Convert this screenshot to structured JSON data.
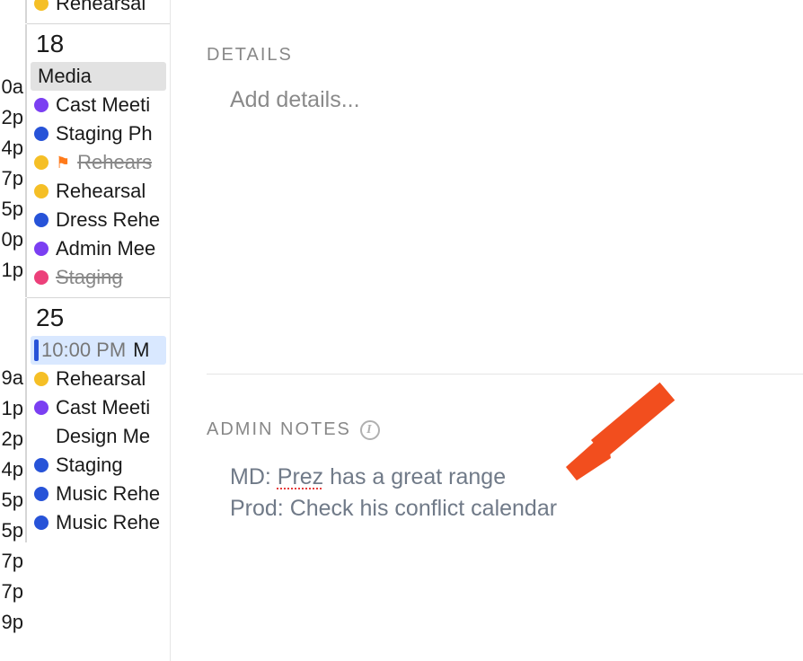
{
  "calendar": {
    "partialTop": {
      "events": [
        {
          "color": "yellow",
          "label": "Rehearsal"
        }
      ]
    },
    "days": [
      {
        "number": "18",
        "times": [
          "0a",
          "2p",
          "4p",
          "7p",
          "5p",
          "0p",
          "1p"
        ],
        "events": [
          {
            "color": "none",
            "label": "Media",
            "selected": true
          },
          {
            "color": "purple",
            "label": "Cast Meeti"
          },
          {
            "color": "blue",
            "label": "Staging Ph"
          },
          {
            "color": "yellow",
            "label": "Rehears",
            "flag": true,
            "strike": true
          },
          {
            "color": "yellow",
            "label": "Rehearsal"
          },
          {
            "color": "blue",
            "label": "Dress Rehe"
          },
          {
            "color": "purple",
            "label": "Admin Mee"
          },
          {
            "color": "pink",
            "label": "Staging",
            "strike": true
          }
        ]
      },
      {
        "number": "25",
        "times": [
          "9a",
          "1p",
          "2p",
          "4p",
          "5p",
          "5p",
          "7p",
          "7p",
          "9p"
        ],
        "events": [
          {
            "color": "none",
            "label": "M",
            "timesel": true,
            "time": "10:00 PM"
          },
          {
            "color": "yellow",
            "label": "Rehearsal"
          },
          {
            "color": "purple",
            "label": "Cast Meeti"
          },
          {
            "color": "none",
            "label": "Design Me"
          },
          {
            "color": "blue",
            "label": "Staging"
          },
          {
            "color": "blue",
            "label": "Music Rehe"
          },
          {
            "color": "blue",
            "label": "Music Rehe"
          }
        ]
      }
    ]
  },
  "detail": {
    "detailsHeader": "DETAILS",
    "addDetailsPlaceholder": "Add details...",
    "notesHeader": "ADMIN NOTES",
    "notesLine1Pre": "MD: ",
    "notesLine1Word": "Prez",
    "notesLine1Post": " has a great range",
    "notesLine2": "Prod: Check his conflict calendar"
  }
}
